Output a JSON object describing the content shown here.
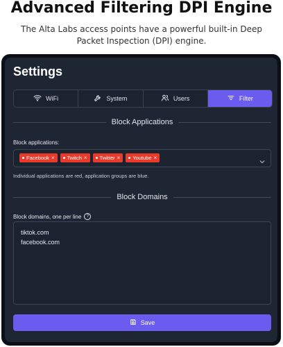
{
  "headline": "Advanced Filtering  DPI Engine",
  "subtitle_line1": "The Alta Labs access points have a powerful built-in Deep",
  "subtitle_line2": "Packet Inspection (DPI) engine.",
  "settings": {
    "title": "Settings",
    "tabs": [
      {
        "label": "WiFi",
        "icon": "wifi-icon",
        "active": false
      },
      {
        "label": "System",
        "icon": "wrench-icon",
        "active": false
      },
      {
        "label": "Users",
        "icon": "users-icon",
        "active": false
      },
      {
        "label": "Filter",
        "icon": "filter-icon",
        "active": true
      }
    ],
    "block_applications": {
      "section_title": "Block Applications",
      "field_label": "Block applications:",
      "chips": [
        "Facebook",
        "Twitch",
        "Twitter",
        "Youtube"
      ],
      "hint": "Individual applications are red, application groups are blue."
    },
    "block_domains": {
      "section_title": "Block Domains",
      "field_label": "Block domains, one per line",
      "domains": [
        "tiktok.com",
        "facebook.com"
      ]
    },
    "save_label": "Save"
  },
  "colors": {
    "accent": "#6b5cf0",
    "chip_red": "#e83b2c",
    "panel": "#1e2533",
    "frame": "#0b0f16"
  }
}
